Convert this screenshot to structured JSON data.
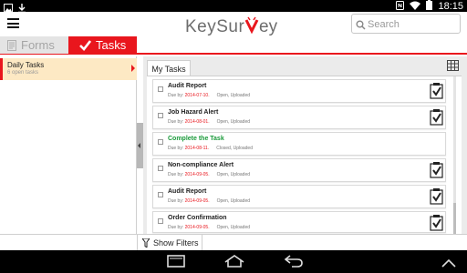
{
  "status_bar": {
    "time": "18:15",
    "icons": [
      "image-icon",
      "download-icon",
      "nfc-icon",
      "wifi-icon",
      "battery-icon"
    ]
  },
  "app": {
    "logo_text": "KeySurvey",
    "menu_icon": "hamburger-icon"
  },
  "search": {
    "placeholder": "Search",
    "value": ""
  },
  "tabs": {
    "forms_label": "Forms",
    "tasks_label": "Tasks"
  },
  "left_panel": {
    "item": {
      "title": "Daily Tasks",
      "subtitle": "6 open tasks"
    }
  },
  "main": {
    "tab_label": "My Tasks",
    "tasks": [
      {
        "title": "Audit Report",
        "due_prefix": "Due by: ",
        "due": "2014-07-10.",
        "status": "Open, Uploaded"
      },
      {
        "title": "Job Hazard Alert",
        "due_prefix": "Due by: ",
        "due": "2014-08-01.",
        "status": "Open, Uploaded"
      },
      {
        "title": "Complete the Task",
        "due_prefix": "Due by: ",
        "due": "2014-08-11.",
        "status": "Closed, Uploaded"
      },
      {
        "title": "Non-compliance Alert",
        "due_prefix": "Due by: ",
        "due": "2014-09-05.",
        "status": "Open, Uploaded"
      },
      {
        "title": "Audit Report",
        "due_prefix": "Due by: ",
        "due": "2014-09-05.",
        "status": "Open, Uploaded"
      },
      {
        "title": "Order Confirmation",
        "due_prefix": "Due by: ",
        "due": "2014-09-05.",
        "status": "Open, Uploaded"
      }
    ]
  },
  "filter_bar": {
    "show_filters_label": "Show Filters"
  },
  "colors": {
    "accent": "#e9161d",
    "selected_bg": "#fde9c4",
    "closed_green": "#1a9a3a"
  }
}
